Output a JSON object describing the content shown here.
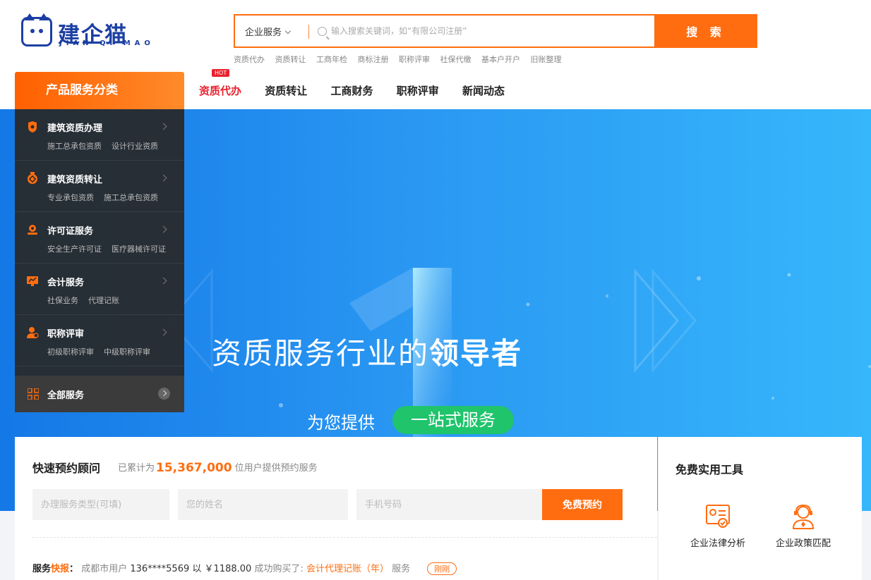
{
  "logo": {
    "title": "建企猫",
    "subtitle": "JIAN QI MAO"
  },
  "search": {
    "select_label": "企业服务",
    "placeholder": "输入搜索关键词，如“有限公司注册”",
    "button": "搜 索",
    "hot_links": [
      "资质代办",
      "资质转让",
      "工商年检",
      "商标注册",
      "职称评审",
      "社保代缴",
      "基本户开户",
      "旧账整理"
    ]
  },
  "nav": {
    "category_header": "产品服务分类",
    "hot_badge": "HOT",
    "items": [
      "资质代办",
      "资质转让",
      "工商财务",
      "职称评审",
      "新闻动态"
    ]
  },
  "categories": [
    {
      "title": "建筑资质办理",
      "icon": "badge-icon",
      "links": [
        "施工总承包资质",
        "设计行业资质"
      ]
    },
    {
      "title": "建筑资质转让",
      "icon": "medal-icon",
      "links": [
        "专业承包资质",
        "施工总承包资质"
      ]
    },
    {
      "title": "许可证服务",
      "icon": "license-icon",
      "links": [
        "安全生产许可证",
        "医疗器械许可证"
      ]
    },
    {
      "title": "会计服务",
      "icon": "monitor-icon",
      "links": [
        "社保业务",
        "代理记账"
      ]
    },
    {
      "title": "职称评审",
      "icon": "person-icon",
      "links": [
        "初级职称评审",
        "中级职称评审"
      ]
    }
  ],
  "all_services": "全部服务",
  "banner": {
    "slogan_normal": "资质服务行业的",
    "slogan_bold": "领导者",
    "sub_prefix": "为您提供",
    "sub_highlight": "一站式服务"
  },
  "booking": {
    "title": "快速预约顾问",
    "stat_prefix": "已累计为",
    "stat_number": "15,367,000",
    "stat_suffix": "位用户提供预约服务",
    "field_service_placeholder": "办理服务类型(可填)",
    "field_name_placeholder": "您的姓名",
    "field_phone_placeholder": "手机号码",
    "button": "免费预约"
  },
  "ticker": {
    "label_a": "服务",
    "label_b": "快报",
    "colon": "：",
    "city_user": "成都市用户",
    "phone": "136****5569",
    "with_text": "以",
    "price": "￥1188.00",
    "bought": "成功购买了:",
    "product": "会计代理记账（年）",
    "service_word": "服务",
    "time_tag": "刚刚"
  },
  "tools": {
    "title": "免费实用工具",
    "items": [
      "企业法律分析",
      "企业政策匹配"
    ]
  },
  "colors": {
    "accent": "#ff6d10",
    "hot_red": "#e8212d",
    "brand_blue": "#1c3fa3",
    "pill_green": "#1fc46b"
  }
}
